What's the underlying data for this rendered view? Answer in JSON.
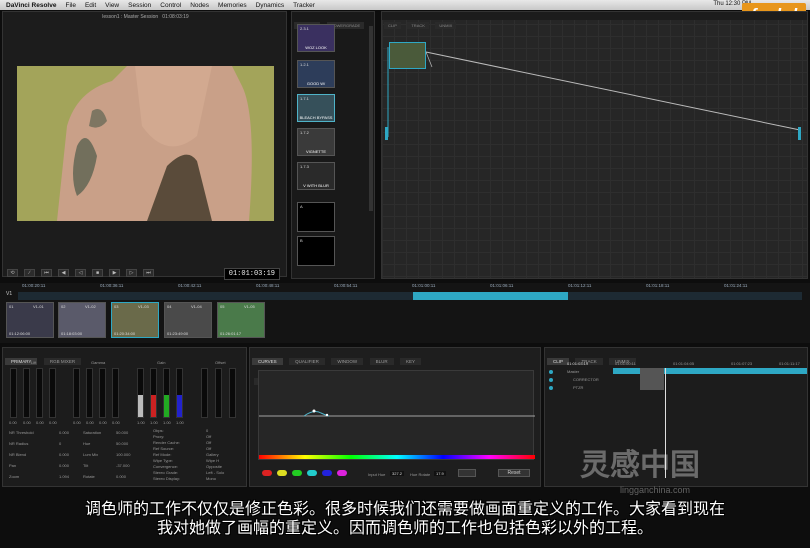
{
  "menubar": {
    "app": "DaVinci Resolve",
    "items": [
      "File",
      "Edit",
      "View",
      "Session",
      "Control",
      "Nodes",
      "Memories",
      "Dynamics",
      "Tracker"
    ],
    "clock": "Thu 12:30 PM"
  },
  "logo": "fxphd",
  "viewer": {
    "title": "lesson1 : Master Session",
    "timecode_top": "01:08:03:19",
    "timecode": "01:01:03:19"
  },
  "gallery": {
    "tabs": [
      "GALLERY",
      "POWERGRADE"
    ],
    "stills": [
      {
        "num": "2.3.1",
        "label": "WOZ LOOK"
      },
      {
        "num": "1.2.1",
        "label": "GOOD W/"
      },
      {
        "num": "1.7.1",
        "label": "BLEACH BYPASS"
      },
      {
        "num": "1.7.2",
        "label": "VIGNETTE"
      },
      {
        "num": "1.7.3",
        "label": "V WITH BLUR"
      }
    ],
    "slots": [
      "A",
      "B"
    ]
  },
  "nodegraph": {
    "tabs": [
      "CLIP",
      "TRACK",
      "UNMIX"
    ]
  },
  "timeline": {
    "rulers": [
      "01:00:20:11",
      "01:00:36:11",
      "01:00:42:11",
      "01:00:48:11",
      "01:00:54:11",
      "01:01:00:11",
      "01:01:06:11",
      "01:01:12:11",
      "01:01:18:11",
      "01:01:24:11"
    ],
    "track_label": "V1",
    "clips": [
      {
        "num": "01",
        "id": "V1-01",
        "tc": "01:12:06:00"
      },
      {
        "num": "02",
        "id": "V1-02",
        "tc": "01:18:03:00"
      },
      {
        "num": "03",
        "id": "V1-03",
        "tc": "01:20:34:00"
      },
      {
        "num": "04",
        "id": "V1-04",
        "tc": "01:23:49:00"
      },
      {
        "num": "05",
        "id": "V1-05",
        "tc": "01:26:01:17"
      }
    ]
  },
  "primary": {
    "tabs": [
      "PRIMARY",
      "RGB MIXER"
    ],
    "wheels": [
      "Lift",
      "Gamma",
      "Gain",
      "Offset"
    ],
    "lift_values": [
      "0.00",
      "0.00",
      "0.00",
      "0.00"
    ],
    "gamma_values": [
      "0.00",
      "0.00",
      "0.00",
      "0.00"
    ],
    "gain_values": [
      "1.00",
      "1.00",
      "1.00",
      "1.00"
    ],
    "params": [
      {
        "label": "NR Threshold",
        "value": "0.000"
      },
      {
        "label": "NR Radius",
        "value": "0"
      },
      {
        "label": "NR Blend",
        "value": "0.000"
      },
      {
        "label": "Pan",
        "value": "0.000"
      },
      {
        "label": "Zoom",
        "value": "1.094"
      }
    ],
    "color_params": [
      {
        "label": "Saturation",
        "value": "50.000"
      },
      {
        "label": "Hue",
        "value": "50.000"
      },
      {
        "label": "Lum Mix",
        "value": "100.000"
      },
      {
        "label": "Tilt",
        "value": "-37.000"
      },
      {
        "label": "Rotate",
        "value": "0.000"
      }
    ],
    "info": [
      {
        "label": "Obps:",
        "value": "0"
      },
      {
        "label": "Proxy:",
        "value": "Off"
      },
      {
        "label": "Render Cache:",
        "value": "Off"
      },
      {
        "label": "Ref Source:",
        "value": "Off"
      },
      {
        "label": "Ref Mode:",
        "value": "Gallery"
      },
      {
        "label": "Wipe Type:",
        "value": "Wipe H"
      },
      {
        "label": "Convergence:",
        "value": "Opposite"
      },
      {
        "label": "Stereo Grade:",
        "value": "Left - Solo"
      },
      {
        "label": "Stereo Display:",
        "value": "Mono"
      }
    ]
  },
  "curves": {
    "tabs": [
      "CURVES",
      "QUALIFIER",
      "WINDOW",
      "BLUR",
      "KEY"
    ],
    "subtabs": [
      "CUSTOM",
      "SOFT CLIP",
      "HUE VS HUE",
      "HUE VS SAT",
      "HUE VS LUM",
      "LUM VS SAT"
    ],
    "input_label": "Input Hue",
    "input_value": "327.2",
    "rotate_label": "Hue Rotate",
    "rotate_value": "17.9",
    "reset": "Reset"
  },
  "keyframes": {
    "tabs": [
      "CLIP",
      "TRACK",
      "UNMIX"
    ],
    "tc_head": "01:01:03:19",
    "ruler": [
      "01:01:00:11",
      "01:01:04:05",
      "01:01:07:23",
      "01:01:11:17"
    ],
    "rows": [
      "Master",
      "CORRECTOR",
      "PTZR"
    ]
  },
  "subtitles": {
    "line1": "调色师的工作不仅仅是修正色彩。很多时候我们还需要做画面重定义的工作。大家看到现在",
    "line2": "我对她做了画幅的重定义。因而调色师的工作也包括色彩以外的工程。"
  },
  "watermark": "灵感中国",
  "watermark_url": "lingganchina.com"
}
